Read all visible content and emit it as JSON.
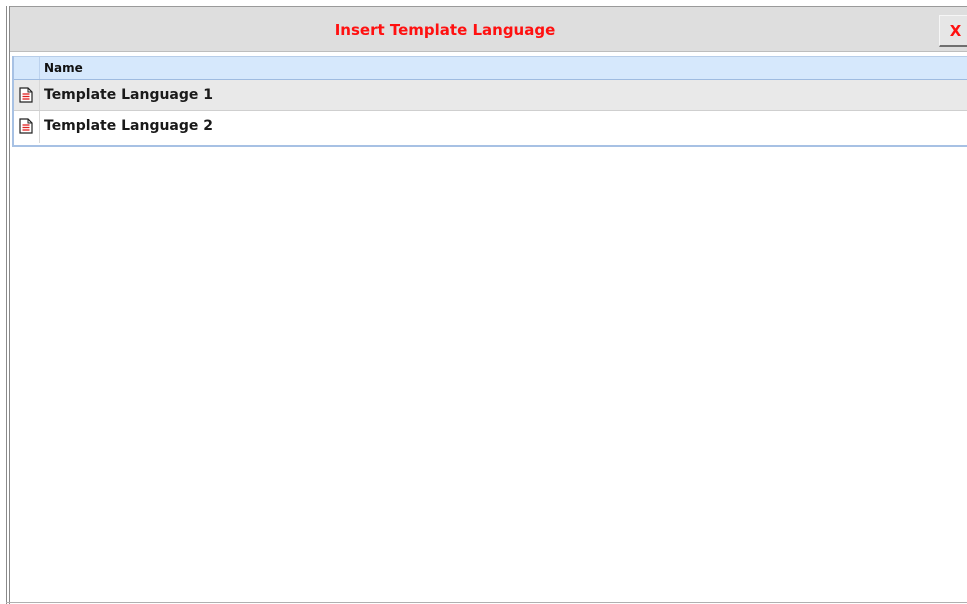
{
  "dialog": {
    "title": "Insert Template Language",
    "close_label": "X"
  },
  "grid": {
    "columns": [
      "Name"
    ],
    "rows": [
      {
        "icon": "document-icon",
        "name": "Template Language 1"
      },
      {
        "icon": "document-icon",
        "name": "Template Language 2"
      }
    ]
  },
  "colors": {
    "title": "#ff1010",
    "header_bg": "#d6e8fc",
    "selected_row_bg": "#e9e9e9",
    "border_accent": "#a7c1e4"
  }
}
